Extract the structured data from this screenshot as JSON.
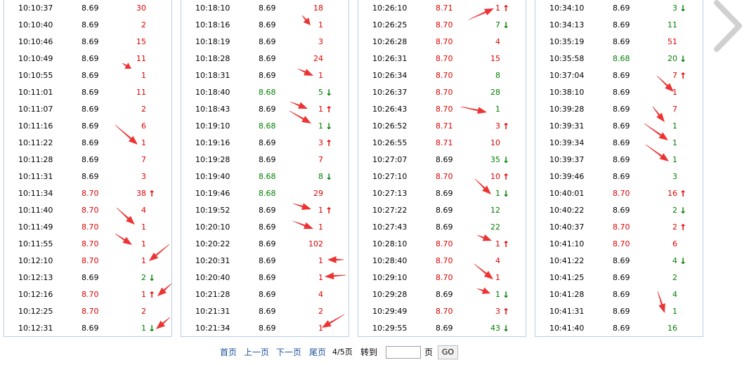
{
  "colors": {
    "red": "#e00000",
    "green": "#008000",
    "accent": "#1b4f9c",
    "panel_border": "#b7cfe6",
    "annotation_arrow": "#ee3333"
  },
  "panels": [
    {
      "rows": [
        {
          "time": "10:10:37",
          "price": "8.69",
          "price_color": "black",
          "vol": "30",
          "vol_color": "red",
          "dir": ""
        },
        {
          "time": "10:10:40",
          "price": "8.69",
          "price_color": "black",
          "vol": "2",
          "vol_color": "red",
          "dir": ""
        },
        {
          "time": "10:10:46",
          "price": "8.69",
          "price_color": "black",
          "vol": "15",
          "vol_color": "red",
          "dir": ""
        },
        {
          "time": "10:10:49",
          "price": "8.69",
          "price_color": "black",
          "vol": "11",
          "vol_color": "red",
          "dir": ""
        },
        {
          "time": "10:10:55",
          "price": "8.69",
          "price_color": "black",
          "vol": "1",
          "vol_color": "red",
          "dir": ""
        },
        {
          "time": "10:11:01",
          "price": "8.69",
          "price_color": "black",
          "vol": "11",
          "vol_color": "red",
          "dir": ""
        },
        {
          "time": "10:11:07",
          "price": "8.69",
          "price_color": "black",
          "vol": "2",
          "vol_color": "red",
          "dir": ""
        },
        {
          "time": "10:11:16",
          "price": "8.69",
          "price_color": "black",
          "vol": "6",
          "vol_color": "red",
          "dir": ""
        },
        {
          "time": "10:11:22",
          "price": "8.69",
          "price_color": "black",
          "vol": "1",
          "vol_color": "red",
          "dir": ""
        },
        {
          "time": "10:11:28",
          "price": "8.69",
          "price_color": "black",
          "vol": "7",
          "vol_color": "red",
          "dir": ""
        },
        {
          "time": "10:11:31",
          "price": "8.69",
          "price_color": "black",
          "vol": "3",
          "vol_color": "red",
          "dir": ""
        },
        {
          "time": "10:11:34",
          "price": "8.70",
          "price_color": "red",
          "vol": "38",
          "vol_color": "red",
          "dir": "up"
        },
        {
          "time": "10:11:40",
          "price": "8.70",
          "price_color": "red",
          "vol": "4",
          "vol_color": "red",
          "dir": ""
        },
        {
          "time": "10:11:49",
          "price": "8.70",
          "price_color": "red",
          "vol": "1",
          "vol_color": "red",
          "dir": ""
        },
        {
          "time": "10:11:55",
          "price": "8.70",
          "price_color": "red",
          "vol": "1",
          "vol_color": "red",
          "dir": ""
        },
        {
          "time": "10:12:10",
          "price": "8.70",
          "price_color": "red",
          "vol": "1",
          "vol_color": "red",
          "dir": ""
        },
        {
          "time": "10:12:13",
          "price": "8.69",
          "price_color": "black",
          "vol": "2",
          "vol_color": "green",
          "dir": "down"
        },
        {
          "time": "10:12:16",
          "price": "8.70",
          "price_color": "red",
          "vol": "1",
          "vol_color": "red",
          "dir": "up"
        },
        {
          "time": "10:12:25",
          "price": "8.70",
          "price_color": "red",
          "vol": "2",
          "vol_color": "red",
          "dir": ""
        },
        {
          "time": "10:12:31",
          "price": "8.69",
          "price_color": "black",
          "vol": "1",
          "vol_color": "green",
          "dir": "down"
        }
      ]
    },
    {
      "rows": [
        {
          "time": "10:18:10",
          "price": "8.69",
          "price_color": "black",
          "vol": "18",
          "vol_color": "red",
          "dir": ""
        },
        {
          "time": "10:18:16",
          "price": "8.69",
          "price_color": "black",
          "vol": "1",
          "vol_color": "red",
          "dir": ""
        },
        {
          "time": "10:18:19",
          "price": "8.69",
          "price_color": "black",
          "vol": "3",
          "vol_color": "red",
          "dir": ""
        },
        {
          "time": "10:18:28",
          "price": "8.69",
          "price_color": "black",
          "vol": "24",
          "vol_color": "red",
          "dir": ""
        },
        {
          "time": "10:18:31",
          "price": "8.69",
          "price_color": "black",
          "vol": "1",
          "vol_color": "red",
          "dir": ""
        },
        {
          "time": "10:18:40",
          "price": "8.68",
          "price_color": "green",
          "vol": "5",
          "vol_color": "green",
          "dir": "down"
        },
        {
          "time": "10:18:43",
          "price": "8.69",
          "price_color": "black",
          "vol": "1",
          "vol_color": "red",
          "dir": "up"
        },
        {
          "time": "10:19:10",
          "price": "8.68",
          "price_color": "green",
          "vol": "1",
          "vol_color": "green",
          "dir": "down"
        },
        {
          "time": "10:19:16",
          "price": "8.69",
          "price_color": "black",
          "vol": "3",
          "vol_color": "red",
          "dir": "up"
        },
        {
          "time": "10:19:28",
          "price": "8.69",
          "price_color": "black",
          "vol": "7",
          "vol_color": "red",
          "dir": ""
        },
        {
          "time": "10:19:40",
          "price": "8.68",
          "price_color": "green",
          "vol": "8",
          "vol_color": "green",
          "dir": "down"
        },
        {
          "time": "10:19:46",
          "price": "8.68",
          "price_color": "green",
          "vol": "29",
          "vol_color": "red",
          "dir": ""
        },
        {
          "time": "10:19:52",
          "price": "8.69",
          "price_color": "black",
          "vol": "1",
          "vol_color": "red",
          "dir": "up"
        },
        {
          "time": "10:20:10",
          "price": "8.69",
          "price_color": "black",
          "vol": "1",
          "vol_color": "red",
          "dir": ""
        },
        {
          "time": "10:20:22",
          "price": "8.69",
          "price_color": "black",
          "vol": "102",
          "vol_color": "red",
          "dir": ""
        },
        {
          "time": "10:20:31",
          "price": "8.69",
          "price_color": "black",
          "vol": "1",
          "vol_color": "red",
          "dir": ""
        },
        {
          "time": "10:20:40",
          "price": "8.69",
          "price_color": "black",
          "vol": "1",
          "vol_color": "red",
          "dir": ""
        },
        {
          "time": "10:21:28",
          "price": "8.69",
          "price_color": "black",
          "vol": "4",
          "vol_color": "red",
          "dir": ""
        },
        {
          "time": "10:21:31",
          "price": "8.69",
          "price_color": "black",
          "vol": "2",
          "vol_color": "red",
          "dir": ""
        },
        {
          "time": "10:21:34",
          "price": "8.69",
          "price_color": "black",
          "vol": "1",
          "vol_color": "red",
          "dir": ""
        }
      ]
    },
    {
      "rows": [
        {
          "time": "10:26:10",
          "price": "8.71",
          "price_color": "red",
          "vol": "1",
          "vol_color": "red",
          "dir": "up"
        },
        {
          "time": "10:26:25",
          "price": "8.70",
          "price_color": "red",
          "vol": "7",
          "vol_color": "green",
          "dir": "down"
        },
        {
          "time": "10:26:28",
          "price": "8.70",
          "price_color": "red",
          "vol": "4",
          "vol_color": "red",
          "dir": ""
        },
        {
          "time": "10:26:31",
          "price": "8.70",
          "price_color": "red",
          "vol": "15",
          "vol_color": "red",
          "dir": ""
        },
        {
          "time": "10:26:34",
          "price": "8.70",
          "price_color": "red",
          "vol": "8",
          "vol_color": "green",
          "dir": ""
        },
        {
          "time": "10:26:37",
          "price": "8.70",
          "price_color": "red",
          "vol": "28",
          "vol_color": "green",
          "dir": ""
        },
        {
          "time": "10:26:43",
          "price": "8.70",
          "price_color": "red",
          "vol": "1",
          "vol_color": "green",
          "dir": ""
        },
        {
          "time": "10:26:52",
          "price": "8.71",
          "price_color": "red",
          "vol": "3",
          "vol_color": "red",
          "dir": "up"
        },
        {
          "time": "10:26:55",
          "price": "8.71",
          "price_color": "red",
          "vol": "10",
          "vol_color": "red",
          "dir": ""
        },
        {
          "time": "10:27:07",
          "price": "8.69",
          "price_color": "black",
          "vol": "35",
          "vol_color": "green",
          "dir": "down"
        },
        {
          "time": "10:27:10",
          "price": "8.70",
          "price_color": "red",
          "vol": "10",
          "vol_color": "red",
          "dir": "up"
        },
        {
          "time": "10:27:13",
          "price": "8.69",
          "price_color": "black",
          "vol": "1",
          "vol_color": "green",
          "dir": "down"
        },
        {
          "time": "10:27:22",
          "price": "8.69",
          "price_color": "black",
          "vol": "12",
          "vol_color": "green",
          "dir": ""
        },
        {
          "time": "10:27:43",
          "price": "8.69",
          "price_color": "black",
          "vol": "22",
          "vol_color": "green",
          "dir": ""
        },
        {
          "time": "10:28:10",
          "price": "8.70",
          "price_color": "red",
          "vol": "1",
          "vol_color": "red",
          "dir": "up"
        },
        {
          "time": "10:28:40",
          "price": "8.70",
          "price_color": "red",
          "vol": "4",
          "vol_color": "red",
          "dir": ""
        },
        {
          "time": "10:29:10",
          "price": "8.70",
          "price_color": "red",
          "vol": "1",
          "vol_color": "red",
          "dir": ""
        },
        {
          "time": "10:29:28",
          "price": "8.69",
          "price_color": "black",
          "vol": "1",
          "vol_color": "green",
          "dir": "down"
        },
        {
          "time": "10:29:49",
          "price": "8.70",
          "price_color": "red",
          "vol": "3",
          "vol_color": "red",
          "dir": "up"
        },
        {
          "time": "10:29:55",
          "price": "8.69",
          "price_color": "black",
          "vol": "43",
          "vol_color": "green",
          "dir": "down"
        }
      ]
    },
    {
      "rows": [
        {
          "time": "10:34:10",
          "price": "8.69",
          "price_color": "black",
          "vol": "3",
          "vol_color": "green",
          "dir": "down"
        },
        {
          "time": "10:34:13",
          "price": "8.69",
          "price_color": "black",
          "vol": "11",
          "vol_color": "green",
          "dir": ""
        },
        {
          "time": "10:35:19",
          "price": "8.69",
          "price_color": "black",
          "vol": "51",
          "vol_color": "red",
          "dir": ""
        },
        {
          "time": "10:35:58",
          "price": "8.68",
          "price_color": "green",
          "vol": "20",
          "vol_color": "green",
          "dir": "down"
        },
        {
          "time": "10:37:04",
          "price": "8.69",
          "price_color": "black",
          "vol": "7",
          "vol_color": "red",
          "dir": "up"
        },
        {
          "time": "10:38:10",
          "price": "8.69",
          "price_color": "black",
          "vol": "1",
          "vol_color": "red",
          "dir": ""
        },
        {
          "time": "10:39:28",
          "price": "8.69",
          "price_color": "black",
          "vol": "7",
          "vol_color": "red",
          "dir": ""
        },
        {
          "time": "10:39:31",
          "price": "8.69",
          "price_color": "black",
          "vol": "1",
          "vol_color": "green",
          "dir": ""
        },
        {
          "time": "10:39:34",
          "price": "8.69",
          "price_color": "black",
          "vol": "1",
          "vol_color": "green",
          "dir": ""
        },
        {
          "time": "10:39:37",
          "price": "8.69",
          "price_color": "black",
          "vol": "1",
          "vol_color": "green",
          "dir": ""
        },
        {
          "time": "10:39:46",
          "price": "8.69",
          "price_color": "black",
          "vol": "3",
          "vol_color": "green",
          "dir": ""
        },
        {
          "time": "10:40:01",
          "price": "8.70",
          "price_color": "red",
          "vol": "16",
          "vol_color": "red",
          "dir": "up"
        },
        {
          "time": "10:40:22",
          "price": "8.69",
          "price_color": "black",
          "vol": "2",
          "vol_color": "green",
          "dir": "down"
        },
        {
          "time": "10:40:37",
          "price": "8.70",
          "price_color": "red",
          "vol": "2",
          "vol_color": "red",
          "dir": "up"
        },
        {
          "time": "10:41:10",
          "price": "8.70",
          "price_color": "red",
          "vol": "6",
          "vol_color": "red",
          "dir": ""
        },
        {
          "time": "10:41:22",
          "price": "8.69",
          "price_color": "black",
          "vol": "4",
          "vol_color": "green",
          "dir": "down"
        },
        {
          "time": "10:41:25",
          "price": "8.69",
          "price_color": "black",
          "vol": "2",
          "vol_color": "green",
          "dir": ""
        },
        {
          "time": "10:41:28",
          "price": "8.69",
          "price_color": "black",
          "vol": "4",
          "vol_color": "green",
          "dir": ""
        },
        {
          "time": "10:41:31",
          "price": "8.69",
          "price_color": "black",
          "vol": "1",
          "vol_color": "green",
          "dir": ""
        },
        {
          "time": "10:41:40",
          "price": "8.69",
          "price_color": "black",
          "vol": "16",
          "vol_color": "green",
          "dir": ""
        }
      ]
    }
  ],
  "pager": {
    "first": "首页",
    "prev": "上一页",
    "next": "下一页",
    "last": "尾页",
    "page_info": "4/5页",
    "goto": "转到",
    "page_input_value": "",
    "page_unit": "页",
    "go": "GO"
  },
  "next_icon": "chevron-right-icon"
}
